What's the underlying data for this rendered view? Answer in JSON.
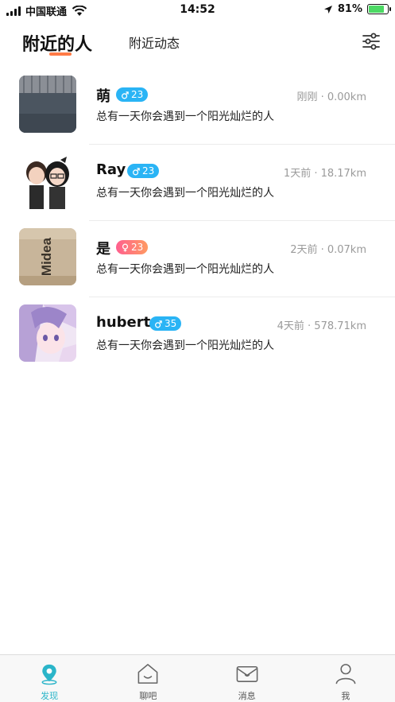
{
  "status_bar": {
    "carrier": "中国联通",
    "time": "14:52",
    "battery": "81%",
    "battery_level": 0.81
  },
  "header": {
    "tab_active": "附近的人",
    "tab_other": "附近动态",
    "filter_icon": "sliders-icon"
  },
  "users": [
    {
      "name": "萌",
      "gender": "male",
      "age": "23",
      "time": "刚刚",
      "distance": "0.00km",
      "meta": "刚刚 · 0.00km",
      "bio": "总有一天你会遇到一个阳光灿烂的人"
    },
    {
      "name": "Ray",
      "gender": "male",
      "age": "23",
      "time": "1天前",
      "distance": "18.17km",
      "meta": "1天前 · 18.17km",
      "bio": "总有一天你会遇到一个阳光灿烂的人"
    },
    {
      "name": "是",
      "gender": "female",
      "age": "23",
      "time": "2天前",
      "distance": "0.07km",
      "meta": "2天前 · 0.07km",
      "bio": "总有一天你会遇到一个阳光灿烂的人"
    },
    {
      "name": "hubert",
      "gender": "male",
      "age": "35",
      "time": "4天前",
      "distance": "578.71km",
      "meta": "4天前 · 578.71km",
      "bio": "总有一天你会遇到一个阳光灿烂的人"
    }
  ],
  "avatar_text_3": "Midea",
  "tabbar": [
    {
      "label": "发现",
      "icon": "location-pin-icon",
      "active": true
    },
    {
      "label": "聊吧",
      "icon": "home-chat-icon",
      "active": false
    },
    {
      "label": "消息",
      "icon": "mail-icon",
      "active": false
    },
    {
      "label": "我",
      "icon": "person-icon",
      "active": false
    }
  ],
  "colors": {
    "accent": "#2bb5c9",
    "underline": "#ff7a45",
    "male_badge": "#2ab4f5",
    "female_badge": "#ff6f86"
  }
}
